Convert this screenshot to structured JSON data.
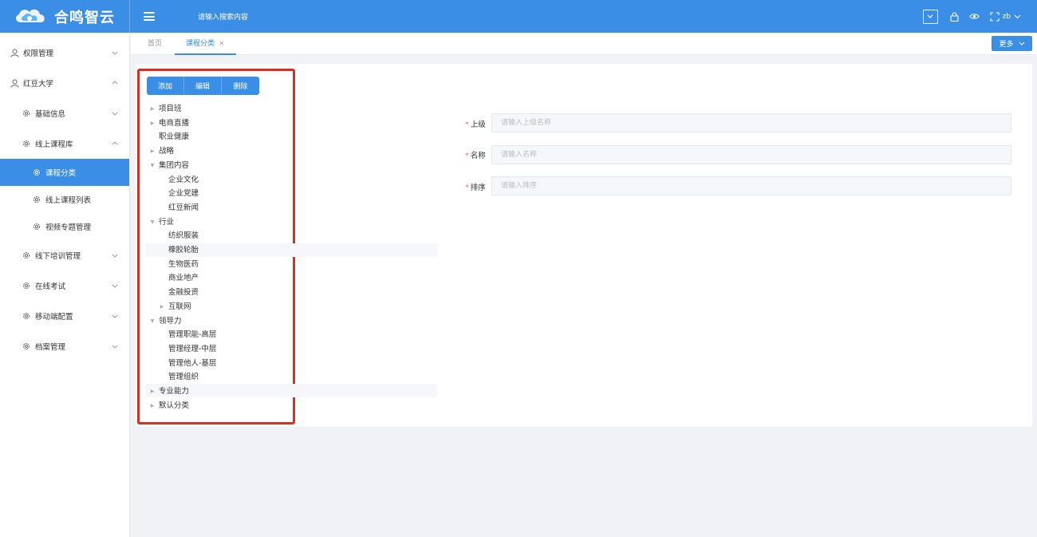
{
  "header": {
    "brand": "合鸣智云",
    "search_placeholder": "请输入搜索内容",
    "user": "zb",
    "brand_color": "#3a8ee6"
  },
  "sidebar": {
    "items": [
      {
        "label": "权限管理",
        "icon": "user-icon",
        "expanded": false
      },
      {
        "label": "红豆大学",
        "icon": "user-icon",
        "expanded": true
      },
      {
        "label": "基础信息",
        "icon": "gear-icon",
        "expanded": false
      },
      {
        "label": "线上课程库",
        "icon": "gear-icon",
        "expanded": true
      },
      {
        "label": "课程分类",
        "icon": "gear-icon",
        "active": true
      },
      {
        "label": "线上课程列表",
        "icon": "gear-icon"
      },
      {
        "label": "视频专题管理",
        "icon": "gear-icon"
      },
      {
        "label": "线下培训管理",
        "icon": "gear-icon",
        "expanded": false
      },
      {
        "label": "在线考试",
        "icon": "gear-icon",
        "expanded": false
      },
      {
        "label": "移动端配置",
        "icon": "gear-icon",
        "expanded": false
      },
      {
        "label": "档案管理",
        "icon": "gear-icon",
        "expanded": false
      }
    ]
  },
  "tabs": {
    "items": [
      {
        "label": "首页"
      },
      {
        "label": "课程分类",
        "active": true
      }
    ],
    "close_glyph": "×",
    "more_label": "更多"
  },
  "toolbar": {
    "add_label": "添加",
    "edit_label": "编辑",
    "delete_label": "删除"
  },
  "tree": [
    {
      "label": "项目班",
      "arrow": "collapsed"
    },
    {
      "label": "电商直播",
      "arrow": "collapsed"
    },
    {
      "label": "职业健康",
      "arrow": "none"
    },
    {
      "label": "战略",
      "arrow": "collapsed"
    },
    {
      "label": "集团内容",
      "arrow": "expanded"
    },
    {
      "label": "企业文化",
      "arrow": "none"
    },
    {
      "label": "企业党建",
      "arrow": "none"
    },
    {
      "label": "红豆新闻",
      "arrow": "none"
    },
    {
      "label": "行业",
      "arrow": "expanded"
    },
    {
      "label": "纺织服装",
      "arrow": "none"
    },
    {
      "label": "橡胶轮胎",
      "arrow": "none"
    },
    {
      "label": "生物医药",
      "arrow": "none"
    },
    {
      "label": "商业地产",
      "arrow": "none"
    },
    {
      "label": "金融投资",
      "arrow": "none"
    },
    {
      "label": "互联网",
      "arrow": "collapsed"
    },
    {
      "label": "领导力",
      "arrow": "expanded"
    },
    {
      "label": "管理职能-高层",
      "arrow": "none"
    },
    {
      "label": "管理经理-中层",
      "arrow": "none"
    },
    {
      "label": "管理他人-基层",
      "arrow": "none"
    },
    {
      "label": "管理组织",
      "arrow": "none"
    },
    {
      "label": "专业能力",
      "arrow": "collapsed"
    },
    {
      "label": "默认分类",
      "arrow": "collapsed"
    }
  ],
  "form": {
    "required_mark": "*",
    "parent_label": "上级",
    "parent_placeholder": "请输入上级名称",
    "name_label": "名称",
    "name_placeholder": "请输入名称",
    "sort_label": "排序",
    "sort_placeholder": "请输入排序"
  }
}
